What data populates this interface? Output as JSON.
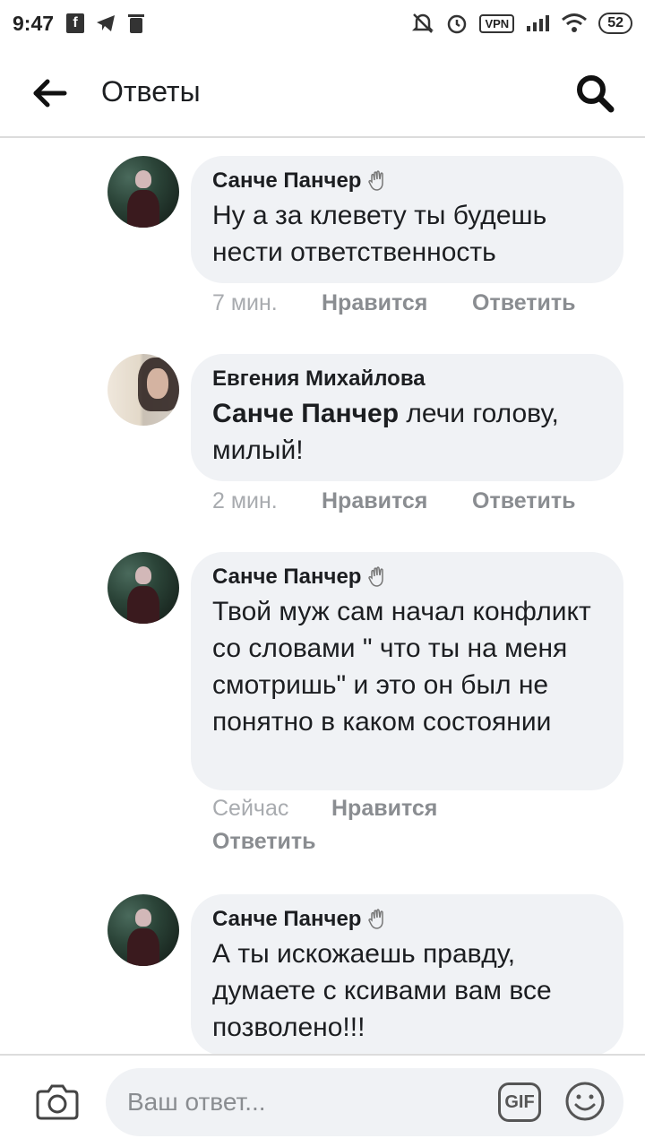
{
  "status_bar": {
    "time": "9:47",
    "vpn": "VPN",
    "battery": "52"
  },
  "header": {
    "title": "Ответы"
  },
  "comments": [
    {
      "author": "Санче Панчер",
      "mention": "",
      "text": "Ну а за клевету ты будешь нести ответственность",
      "time": "7 мин.",
      "like": "Нравится",
      "reply": "Ответить"
    },
    {
      "author": "Евгения Михайлова",
      "mention": "Санче Панчер",
      "text": " лечи голову, милый!",
      "time": "2 мин.",
      "like": "Нравится",
      "reply": "Ответить"
    },
    {
      "author": "Санче Панчер",
      "mention": "",
      "text": "Твой муж сам начал конфликт со словами \" что ты на меня смотришь\" и это он был не понятно в каком состоянии",
      "time": "Сейчас",
      "like": "Нравится",
      "reply": "Ответить"
    },
    {
      "author": "Санче Панчер",
      "mention": "",
      "text": "А ты искожаешь правду, думаете с ксивами вам все позволено!!!",
      "time": "",
      "like": "",
      "reply": ""
    }
  ],
  "composer": {
    "placeholder": "Ваш ответ...",
    "gif_label": "GIF"
  },
  "icons": {
    "back": "arrow-left-icon",
    "search": "search-icon",
    "wave": "waving-hand-icon",
    "camera": "camera-icon",
    "emoji": "emoji-smile-icon"
  }
}
